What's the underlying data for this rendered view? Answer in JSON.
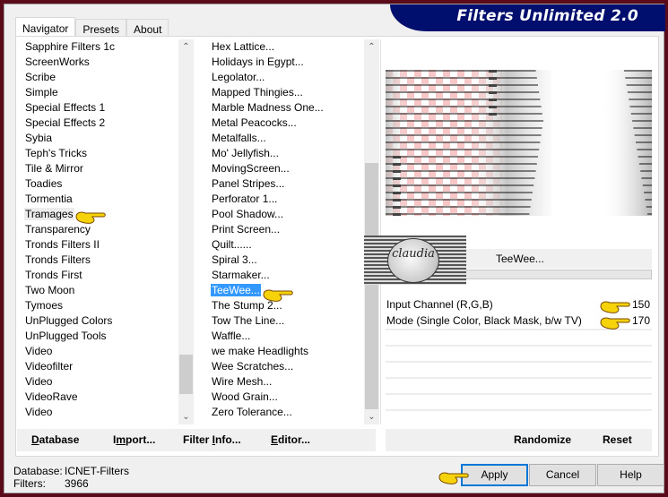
{
  "window": {
    "title": "Filters Unlimited 2.0",
    "border_color": "#5a0a18",
    "banner_color": "#000f6e"
  },
  "tabs": [
    {
      "label": "Navigator",
      "active": true
    },
    {
      "label": "Presets",
      "active": false
    },
    {
      "label": "About",
      "active": false
    }
  ],
  "categories": {
    "items": [
      {
        "label": "Sapphire Filters 1c"
      },
      {
        "label": "ScreenWorks"
      },
      {
        "label": "Scribe"
      },
      {
        "label": "Simple"
      },
      {
        "label": "Special Effects 1"
      },
      {
        "label": "Special Effects 2"
      },
      {
        "label": "Sybia"
      },
      {
        "label": "Teph's Tricks"
      },
      {
        "label": "Tile & Mirror"
      },
      {
        "label": "Toadies"
      },
      {
        "label": "Tormentia"
      },
      {
        "label": "Tramages",
        "highlight": true
      },
      {
        "label": "Transparency"
      },
      {
        "label": "Tronds Filters II"
      },
      {
        "label": "Tronds Filters"
      },
      {
        "label": "Tronds First"
      },
      {
        "label": "Two Moon"
      },
      {
        "label": "Tymoes"
      },
      {
        "label": "UnPlugged Colors"
      },
      {
        "label": "UnPlugged Tools"
      },
      {
        "label": "Video"
      },
      {
        "label": "Videofilter"
      },
      {
        "label": "Video"
      },
      {
        "label": "VideoRave"
      },
      {
        "label": "Video"
      }
    ]
  },
  "filters": {
    "items": [
      {
        "label": "Hex Lattice..."
      },
      {
        "label": "Holidays in Egypt..."
      },
      {
        "label": "Legolator..."
      },
      {
        "label": "Mapped Thingies..."
      },
      {
        "label": "Marble Madness One..."
      },
      {
        "label": "Metal Peacocks..."
      },
      {
        "label": "Metalfalls..."
      },
      {
        "label": "Mo' Jellyfish..."
      },
      {
        "label": "MovingScreen..."
      },
      {
        "label": "Panel Stripes..."
      },
      {
        "label": "Perforator 1..."
      },
      {
        "label": "Pool Shadow..."
      },
      {
        "label": "Print Screen..."
      },
      {
        "label": "Quilt......"
      },
      {
        "label": "Spiral 3..."
      },
      {
        "label": "Starmaker..."
      },
      {
        "label": "TeeWee...",
        "selected": true
      },
      {
        "label": "The Stump 2..."
      },
      {
        "label": "Tow The Line..."
      },
      {
        "label": "Waffle..."
      },
      {
        "label": "we make Headlights"
      },
      {
        "label": "Wee Scratches..."
      },
      {
        "label": "Wire Mesh..."
      },
      {
        "label": "Wood Grain..."
      },
      {
        "label": "Zero Tolerance..."
      }
    ]
  },
  "preview": {
    "filter_name": "TeeWee...",
    "watermark": "claudia"
  },
  "parameters": [
    {
      "label": "Input Channel (R,G,B)",
      "value": "150"
    },
    {
      "label": "Mode (Single Color, Black Mask, b/w TV)",
      "value": "170"
    }
  ],
  "left_buttons": {
    "database": "Database",
    "import": "Import...",
    "filter_info": "Filter Info...",
    "editor": "Editor..."
  },
  "right_buttons": {
    "randomize": "Randomize",
    "reset": "Reset"
  },
  "status": {
    "database_label": "Database:",
    "database_value": "ICNET-Filters",
    "filters_label": "Filters:",
    "filters_value": "3966"
  },
  "dialog_buttons": {
    "apply": "Apply",
    "cancel": "Cancel",
    "help": "Help"
  },
  "icons": {
    "scroll_up": "▲",
    "scroll_down": "▼"
  }
}
